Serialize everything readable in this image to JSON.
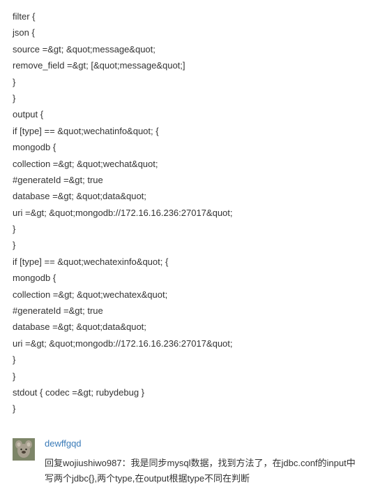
{
  "code": {
    "lines": [
      "filter {",
      "json {",
      "source =&gt; &quot;message&quot;",
      "remove_field =&gt; [&quot;message&quot;]",
      "}",
      "}",
      "",
      "output {",
      "if [type] == &quot;wechatinfo&quot; {",
      "mongodb {",
      "collection =&gt; &quot;wechat&quot;",
      "#generateId =&gt; true",
      "database =&gt; &quot;data&quot;",
      "uri =&gt; &quot;mongodb://172.16.16.236:27017&quot;",
      "}",
      "}",
      "if [type] == &quot;wechatexinfo&quot; {",
      "mongodb {",
      "collection =&gt; &quot;wechatex&quot;",
      "#generateId =&gt; true",
      "database =&gt; &quot;data&quot;",
      "uri =&gt; &quot;mongodb://172.16.16.236:27017&quot;",
      "}",
      "}",
      "stdout { codec =&gt; rubydebug }",
      "}"
    ]
  },
  "reply": {
    "username": "dewffgqd",
    "text": "回复wojiushiwo987：我是同步mysql数据，找到方法了，在jdbc.conf的input中写两个jdbc{},两个type,在output根据type不同在判断"
  }
}
